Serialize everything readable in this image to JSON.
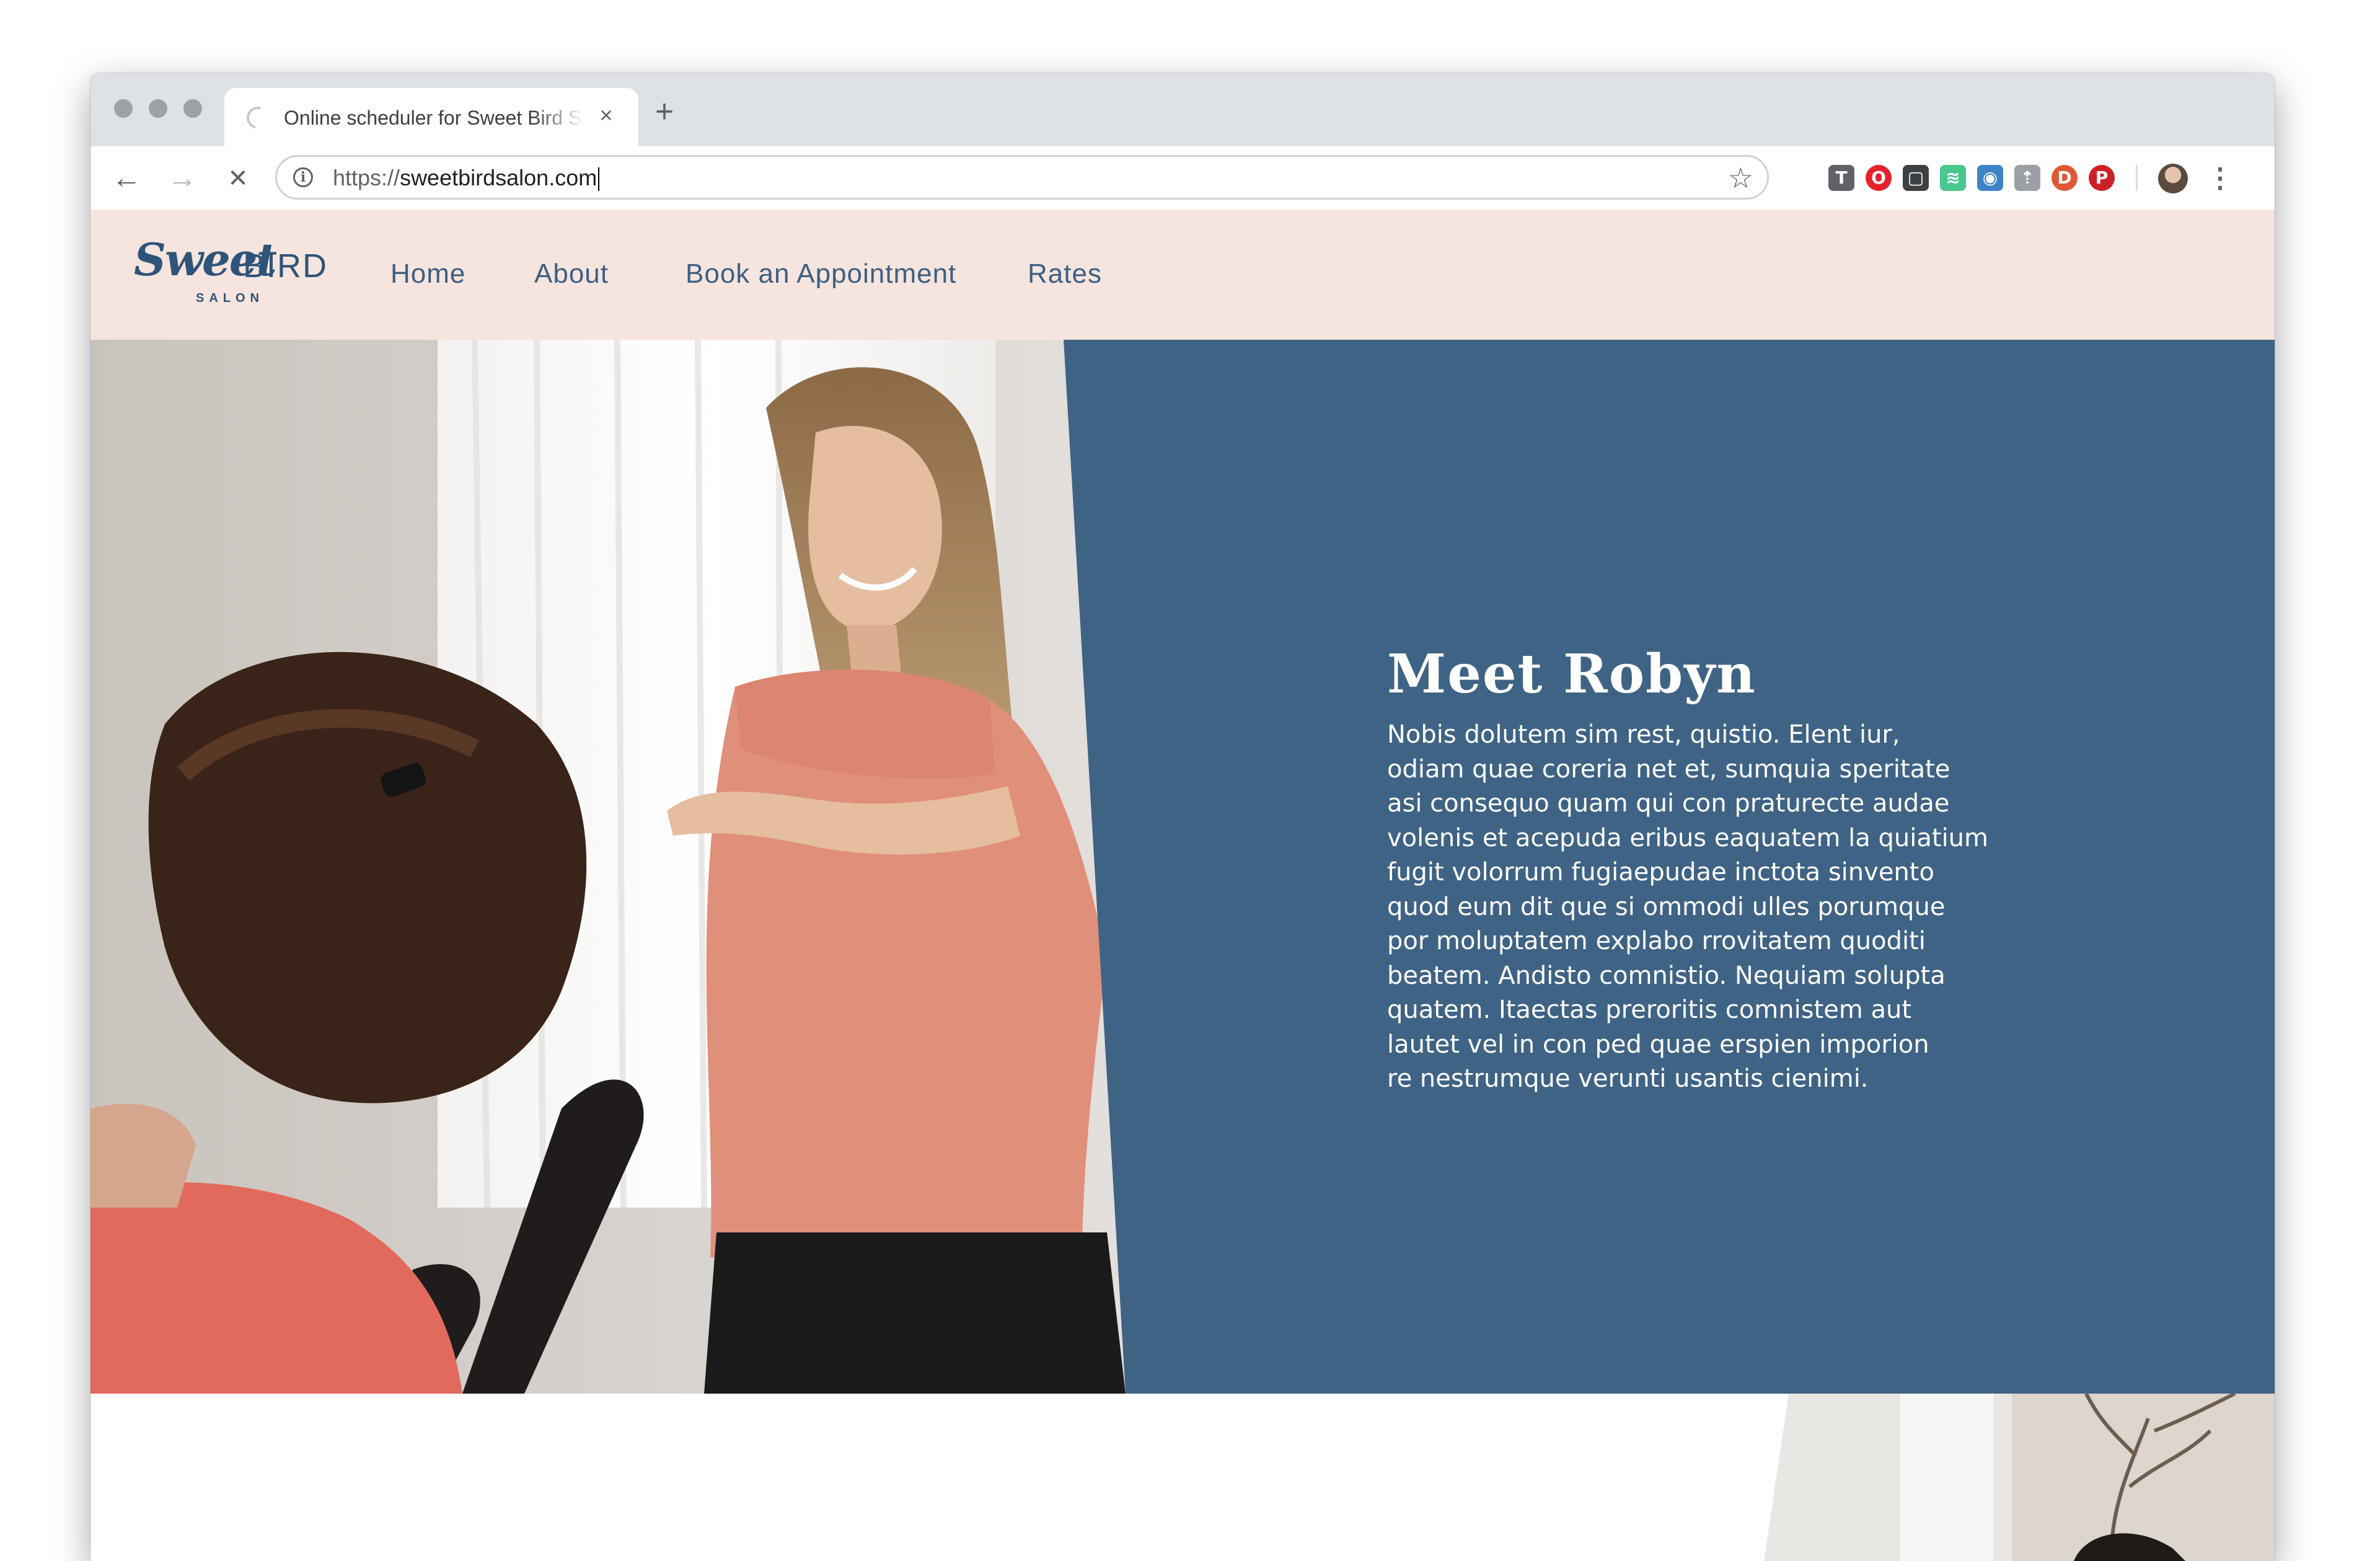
{
  "browser": {
    "tab_title": "Online scheduler for Sweet Bird Salon",
    "tab_close": "×",
    "new_tab": "+",
    "url_scheme": "https://",
    "url_host": "sweetbirdsalon.com",
    "back": "←",
    "forward": "→",
    "stop": "✕",
    "info": "i",
    "star": "☆",
    "menu": "⋮",
    "extensions": [
      {
        "name": "tampermonkey-icon",
        "glyph": "T",
        "color": "#5f6368"
      },
      {
        "name": "opera-icon",
        "glyph": "O",
        "color": "#e8222b"
      },
      {
        "name": "screenshot-icon",
        "glyph": "▢",
        "color": "#3c4043"
      },
      {
        "name": "audio-wave-icon",
        "glyph": "≋",
        "color": "#48c78e"
      },
      {
        "name": "eye-icon",
        "glyph": "◉",
        "color": "#3d84c6"
      },
      {
        "name": "pocket-share-icon",
        "glyph": "⇡",
        "color": "#9aa0a6"
      },
      {
        "name": "duckduckgo-icon",
        "glyph": "D",
        "color": "#de5833"
      },
      {
        "name": "pinterest-icon",
        "glyph": "P",
        "color": "#cb2027"
      }
    ]
  },
  "site": {
    "logo_script": "Sweet",
    "logo_bird": "BIRD",
    "logo_salon": "SALON",
    "nav": [
      "Home",
      "About",
      "Book an Appointment",
      "Rates"
    ]
  },
  "hero": {
    "title": "Meet Robyn",
    "body_lines": [
      "Nobis dolutem sim rest, quistio. Elent iur,",
      "odiam quae coreria net et, sumquia speritate",
      "asi consequo quam qui con praturecte audae",
      "volenis et acepuda eribus eaquatem la quiatium",
      "fugit volorrum fugiaepudae inctota sinvento",
      "quod eum dit que si ommodi ulles porumque",
      "por moluptatem explabo rrovitatem quoditi",
      "beatem. Andisto comnistio. Nequiam solupta",
      "quatem. Itaectas preroritis comnistem aut",
      "lautet vel in con ped quae erspien imporion",
      "re nestrumque verunti usantis cienimi."
    ]
  },
  "colors": {
    "nav_bg": "#f5e5de",
    "brand_blue": "#3f6384",
    "nav_text": "#3e5f81"
  }
}
